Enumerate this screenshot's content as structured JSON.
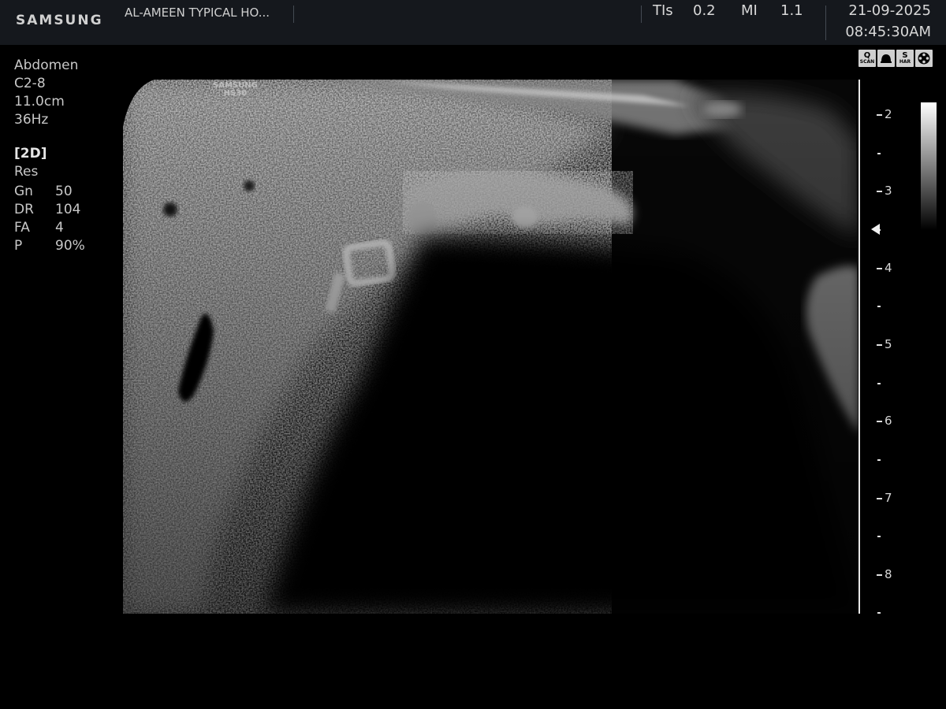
{
  "header": {
    "brand": "SAMSUNG",
    "hospital_name": "AL-AMEEN TYPICAL HO...",
    "indices": [
      {
        "label": "TIs",
        "value": "0.2"
      },
      {
        "label": "MI",
        "value": "1.1"
      }
    ],
    "date": "21-09-2025",
    "time": "08:45:30AM"
  },
  "probe_info": {
    "preset": "Abdomen",
    "probe": "C2-8",
    "depth": "11.0cm",
    "frame_rate": "36Hz"
  },
  "imaging_params": {
    "mode": "[2D]",
    "resolution": "Res",
    "rows": [
      {
        "label": "Gn",
        "value": "50"
      },
      {
        "label": "DR",
        "value": "104"
      },
      {
        "label": "FA",
        "value": "4"
      },
      {
        "label": "P",
        "value": "90%"
      }
    ]
  },
  "scan_icons": [
    {
      "name": "qscan-icon",
      "top": "Q",
      "sub": "SCAN"
    },
    {
      "name": "probe-icon",
      "top": "",
      "sub": ""
    },
    {
      "name": "s-harmonic-icon",
      "top": "S",
      "sub": "HAR"
    },
    {
      "name": "film-reel-icon",
      "top": "",
      "sub": ""
    }
  ],
  "image_watermark": {
    "brand": "SAMSUNG",
    "model": "HS30"
  },
  "depth_scale": {
    "labels": [
      "2",
      "3",
      "4",
      "5",
      "6",
      "7",
      "8"
    ]
  }
}
